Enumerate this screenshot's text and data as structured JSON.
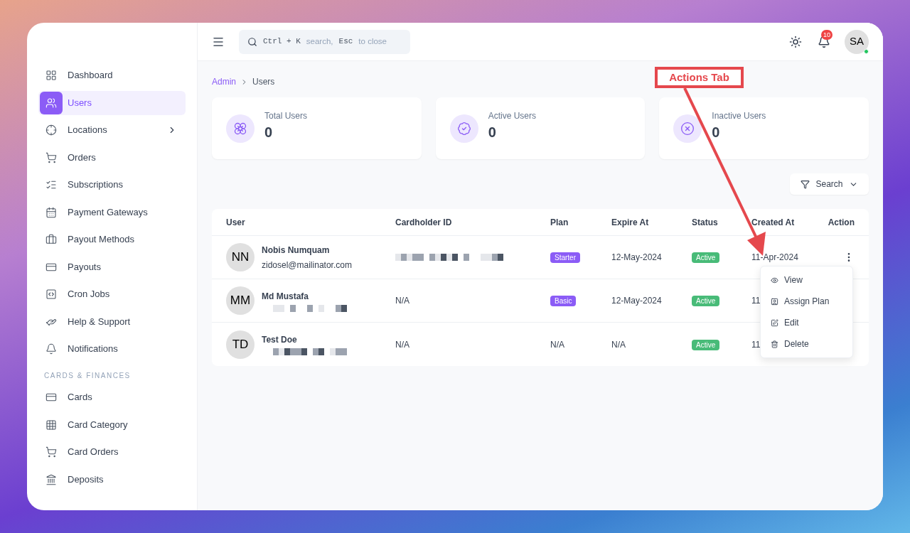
{
  "sidebar": {
    "items": [
      {
        "label": "Dashboard",
        "selected": false
      },
      {
        "label": "Users",
        "selected": true
      },
      {
        "label": "Locations",
        "selected": false,
        "expandable": true
      },
      {
        "label": "Orders",
        "selected": false
      },
      {
        "label": "Subscriptions",
        "selected": false
      },
      {
        "label": "Payment Gateways",
        "selected": false
      },
      {
        "label": "Payout Methods",
        "selected": false
      },
      {
        "label": "Payouts",
        "selected": false
      },
      {
        "label": "Cron Jobs",
        "selected": false
      },
      {
        "label": "Help & Support",
        "selected": false
      },
      {
        "label": "Notifications",
        "selected": false
      }
    ],
    "section": {
      "title": "CARDS & FINANCES",
      "items": [
        {
          "label": "Cards",
          "selected": false
        },
        {
          "label": "Card Category",
          "selected": false
        },
        {
          "label": "Card Orders",
          "selected": false
        },
        {
          "label": "Deposits",
          "selected": false
        }
      ]
    }
  },
  "header": {
    "search": {
      "keys": [
        {
          "key": "Ctrl + K",
          "text": "search,"
        },
        {
          "key": "Esc",
          "text": "to close"
        }
      ]
    },
    "notifications": "10",
    "avatar": {
      "initials": "SA",
      "online": true
    }
  },
  "breadcrumb": [
    "Admin",
    "Users"
  ],
  "stats": [
    {
      "kind": "total",
      "label": "Total Users",
      "value": "0"
    },
    {
      "kind": "active",
      "label": "Active Users",
      "value": "0"
    },
    {
      "kind": "inactive",
      "label": "Inactive Users",
      "value": "0"
    }
  ],
  "filter_button": "Search",
  "table": {
    "columns": [
      "User",
      "Cardholder ID",
      "Plan",
      "Expire At",
      "Status",
      "Created At",
      "Action"
    ],
    "rows": [
      {
        "initials": "NN",
        "name": "Nobis Numquam",
        "email": "zidosel@mailinator.com",
        "cardholder_id": null,
        "plan": "Starter",
        "expire_at": "12-May-2024",
        "status": "Active",
        "created_at": "11-Apr-2024"
      },
      {
        "initials": "MM",
        "name": "Md Mustafa",
        "email": null,
        "cardholder_id": "N/A",
        "plan": "Basic",
        "expire_at": "12-May-2024",
        "status": "Active",
        "created_at": "11"
      },
      {
        "initials": "TD",
        "name": "Test Doe",
        "email": null,
        "cardholder_id": "N/A",
        "plan": "N/A",
        "expire_at": "N/A",
        "status": "Active",
        "created_at": "11"
      }
    ]
  },
  "action_menu": {
    "items": [
      {
        "kind": "view",
        "label": "View"
      },
      {
        "kind": "assign",
        "label": "Assign Plan"
      },
      {
        "kind": "edit",
        "label": "Edit"
      },
      {
        "kind": "delete",
        "label": "Delete"
      }
    ]
  },
  "annotation": {
    "label": "Actions Tab"
  }
}
